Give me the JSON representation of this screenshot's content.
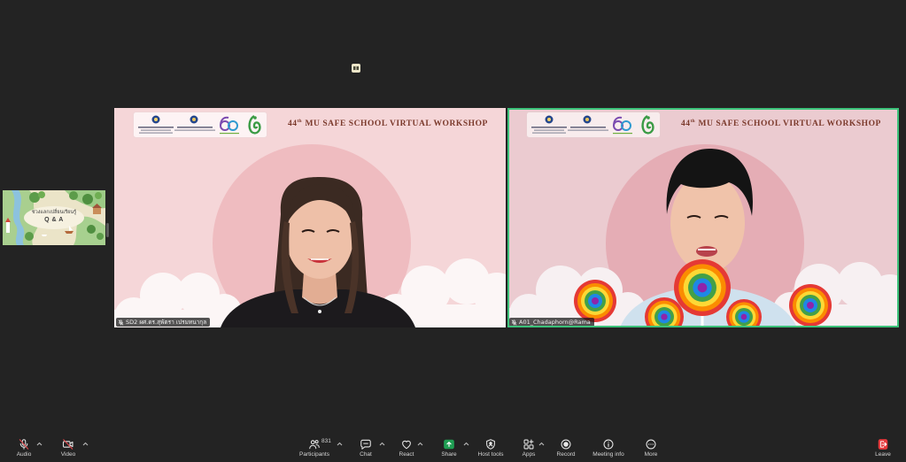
{
  "colors": {
    "background": "#232323",
    "active_speaker_border": "#3cc27a",
    "share": "#1f9e53",
    "leave": "#e5383b",
    "muted": "#e5484d",
    "banner_title": "#7b3a2c",
    "label_text": "#d4d4d4"
  },
  "top_indicator": {
    "icon": "view-icon"
  },
  "shared_content": {
    "icon": "shared-screen-thumbnail",
    "heading_th": "ช่วงแลกเปลี่ยนเรียนรู้",
    "heading": "Q & A"
  },
  "tiles": [
    {
      "banner": {
        "number": "44",
        "suffix": "th",
        "title": "MU SAFE SCHOOL VIRTUAL WORKSHOP"
      },
      "name": "SD2 ผศ.ดร.สุพัตรา เปรมทนากุล",
      "name_icon": "mic-muted-icon",
      "active_speaker": false
    },
    {
      "banner": {
        "number": "44",
        "suffix": "th",
        "title": "MU SAFE SCHOOL VIRTUAL WORKSHOP"
      },
      "name": "A01_Chadaphorn@Rama",
      "name_icon": "mic-muted-icon",
      "active_speaker": true
    }
  ],
  "toolbar": {
    "audio": {
      "label": "Audio",
      "icon": "mic-muted-icon"
    },
    "video": {
      "label": "Video",
      "icon": "video-off-icon"
    },
    "participants": {
      "label": "Participants",
      "count": "831",
      "icon": "participants-icon"
    },
    "chat": {
      "label": "Chat",
      "icon": "chat-icon"
    },
    "react": {
      "label": "React",
      "icon": "heart-icon"
    },
    "share": {
      "label": "Share",
      "icon": "share-screen-icon"
    },
    "host_tools": {
      "label": "Host tools",
      "icon": "shield-icon"
    },
    "apps": {
      "label": "Apps",
      "icon": "apps-icon"
    },
    "record": {
      "label": "Record",
      "icon": "record-icon"
    },
    "meeting_info": {
      "label": "Meeting info",
      "icon": "info-icon"
    },
    "more": {
      "label": "More",
      "icon": "more-icon"
    },
    "leave": {
      "label": "Leave",
      "icon": "leave-icon"
    }
  }
}
